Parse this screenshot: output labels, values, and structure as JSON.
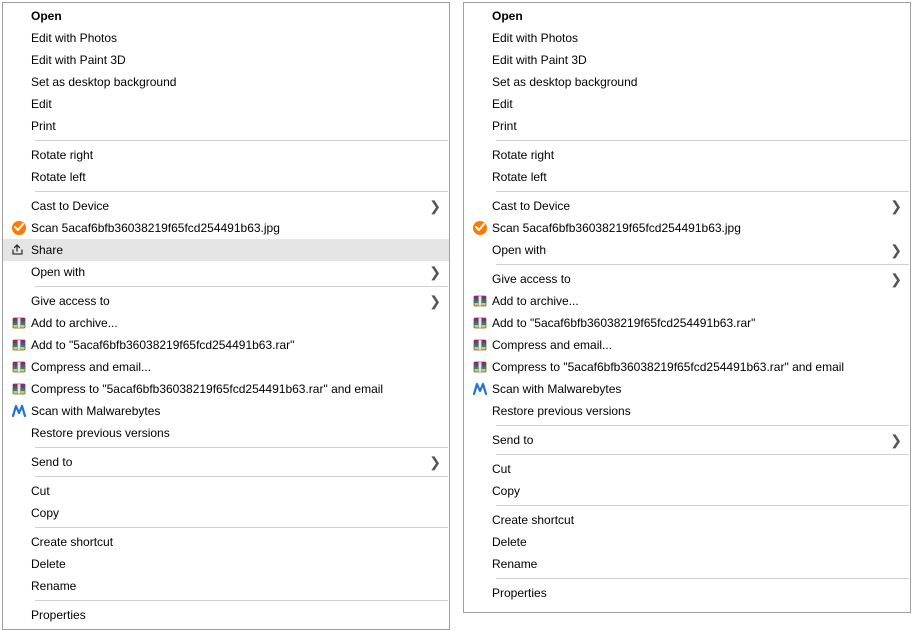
{
  "left_menu": {
    "groups": [
      [
        {
          "id": "open",
          "label": "Open",
          "bold": true,
          "icon": null,
          "submenu": false,
          "highlight": false
        },
        {
          "id": "edit-photos",
          "label": "Edit with Photos",
          "bold": false,
          "icon": null,
          "submenu": false,
          "highlight": false
        },
        {
          "id": "edit-paint3d",
          "label": "Edit with Paint 3D",
          "bold": false,
          "icon": null,
          "submenu": false,
          "highlight": false
        },
        {
          "id": "set-desktop-bg",
          "label": "Set as desktop background",
          "bold": false,
          "icon": null,
          "submenu": false,
          "highlight": false
        },
        {
          "id": "edit",
          "label": "Edit",
          "bold": false,
          "icon": null,
          "submenu": false,
          "highlight": false
        },
        {
          "id": "print",
          "label": "Print",
          "bold": false,
          "icon": null,
          "submenu": false,
          "highlight": false
        }
      ],
      [
        {
          "id": "rotate-right",
          "label": "Rotate right",
          "bold": false,
          "icon": null,
          "submenu": false,
          "highlight": false
        },
        {
          "id": "rotate-left",
          "label": "Rotate left",
          "bold": false,
          "icon": null,
          "submenu": false,
          "highlight": false
        }
      ],
      [
        {
          "id": "cast-to-device",
          "label": "Cast to Device",
          "bold": false,
          "icon": null,
          "submenu": true,
          "highlight": false
        },
        {
          "id": "avast-scan",
          "label": "Scan 5acaf6bfb36038219f65fcd254491b63.jpg",
          "bold": false,
          "icon": "avast",
          "submenu": false,
          "highlight": false
        },
        {
          "id": "share",
          "label": "Share",
          "bold": false,
          "icon": "share",
          "submenu": false,
          "highlight": true
        },
        {
          "id": "open-with",
          "label": "Open with",
          "bold": false,
          "icon": null,
          "submenu": true,
          "highlight": false
        }
      ],
      [
        {
          "id": "give-access-to",
          "label": "Give access to",
          "bold": false,
          "icon": null,
          "submenu": true,
          "highlight": false
        },
        {
          "id": "add-to-archive",
          "label": "Add to archive...",
          "bold": false,
          "icon": "winrar",
          "submenu": false,
          "highlight": false
        },
        {
          "id": "add-to-rar",
          "label": "Add to \"5acaf6bfb36038219f65fcd254491b63.rar\"",
          "bold": false,
          "icon": "winrar",
          "submenu": false,
          "highlight": false
        },
        {
          "id": "compress-email",
          "label": "Compress and email...",
          "bold": false,
          "icon": "winrar",
          "submenu": false,
          "highlight": false
        },
        {
          "id": "compress-to-rar-email",
          "label": "Compress to \"5acaf6bfb36038219f65fcd254491b63.rar\" and email",
          "bold": false,
          "icon": "winrar",
          "submenu": false,
          "highlight": false
        },
        {
          "id": "malwarebytes",
          "label": "Scan with Malwarebytes",
          "bold": false,
          "icon": "malwarebytes",
          "submenu": false,
          "highlight": false
        },
        {
          "id": "restore-prev",
          "label": "Restore previous versions",
          "bold": false,
          "icon": null,
          "submenu": false,
          "highlight": false
        }
      ],
      [
        {
          "id": "send-to",
          "label": "Send to",
          "bold": false,
          "icon": null,
          "submenu": true,
          "highlight": false
        }
      ],
      [
        {
          "id": "cut",
          "label": "Cut",
          "bold": false,
          "icon": null,
          "submenu": false,
          "highlight": false
        },
        {
          "id": "copy",
          "label": "Copy",
          "bold": false,
          "icon": null,
          "submenu": false,
          "highlight": false
        }
      ],
      [
        {
          "id": "create-shortcut",
          "label": "Create shortcut",
          "bold": false,
          "icon": null,
          "submenu": false,
          "highlight": false
        },
        {
          "id": "delete",
          "label": "Delete",
          "bold": false,
          "icon": null,
          "submenu": false,
          "highlight": false
        },
        {
          "id": "rename",
          "label": "Rename",
          "bold": false,
          "icon": null,
          "submenu": false,
          "highlight": false
        }
      ],
      [
        {
          "id": "properties",
          "label": "Properties",
          "bold": false,
          "icon": null,
          "submenu": false,
          "highlight": false
        }
      ]
    ]
  },
  "right_menu": {
    "groups": [
      [
        {
          "id": "open",
          "label": "Open",
          "bold": true,
          "icon": null,
          "submenu": false,
          "highlight": false
        },
        {
          "id": "edit-photos",
          "label": "Edit with Photos",
          "bold": false,
          "icon": null,
          "submenu": false,
          "highlight": false
        },
        {
          "id": "edit-paint3d",
          "label": "Edit with Paint 3D",
          "bold": false,
          "icon": null,
          "submenu": false,
          "highlight": false
        },
        {
          "id": "set-desktop-bg",
          "label": "Set as desktop background",
          "bold": false,
          "icon": null,
          "submenu": false,
          "highlight": false
        },
        {
          "id": "edit",
          "label": "Edit",
          "bold": false,
          "icon": null,
          "submenu": false,
          "highlight": false
        },
        {
          "id": "print",
          "label": "Print",
          "bold": false,
          "icon": null,
          "submenu": false,
          "highlight": false
        }
      ],
      [
        {
          "id": "rotate-right",
          "label": "Rotate right",
          "bold": false,
          "icon": null,
          "submenu": false,
          "highlight": false
        },
        {
          "id": "rotate-left",
          "label": "Rotate left",
          "bold": false,
          "icon": null,
          "submenu": false,
          "highlight": false
        }
      ],
      [
        {
          "id": "cast-to-device",
          "label": "Cast to Device",
          "bold": false,
          "icon": null,
          "submenu": true,
          "highlight": false
        },
        {
          "id": "avast-scan",
          "label": "Scan 5acaf6bfb36038219f65fcd254491b63.jpg",
          "bold": false,
          "icon": "avast",
          "submenu": false,
          "highlight": false
        },
        {
          "id": "open-with",
          "label": "Open with",
          "bold": false,
          "icon": null,
          "submenu": true,
          "highlight": false
        }
      ],
      [
        {
          "id": "give-access-to",
          "label": "Give access to",
          "bold": false,
          "icon": null,
          "submenu": true,
          "highlight": false
        },
        {
          "id": "add-to-archive",
          "label": "Add to archive...",
          "bold": false,
          "icon": "winrar",
          "submenu": false,
          "highlight": false
        },
        {
          "id": "add-to-rar",
          "label": "Add to \"5acaf6bfb36038219f65fcd254491b63.rar\"",
          "bold": false,
          "icon": "winrar",
          "submenu": false,
          "highlight": false
        },
        {
          "id": "compress-email",
          "label": "Compress and email...",
          "bold": false,
          "icon": "winrar",
          "submenu": false,
          "highlight": false
        },
        {
          "id": "compress-to-rar-email",
          "label": "Compress to \"5acaf6bfb36038219f65fcd254491b63.rar\" and email",
          "bold": false,
          "icon": "winrar",
          "submenu": false,
          "highlight": false
        },
        {
          "id": "malwarebytes",
          "label": "Scan with Malwarebytes",
          "bold": false,
          "icon": "malwarebytes",
          "submenu": false,
          "highlight": false
        },
        {
          "id": "restore-prev",
          "label": "Restore previous versions",
          "bold": false,
          "icon": null,
          "submenu": false,
          "highlight": false
        }
      ],
      [
        {
          "id": "send-to",
          "label": "Send to",
          "bold": false,
          "icon": null,
          "submenu": true,
          "highlight": false
        }
      ],
      [
        {
          "id": "cut",
          "label": "Cut",
          "bold": false,
          "icon": null,
          "submenu": false,
          "highlight": false
        },
        {
          "id": "copy",
          "label": "Copy",
          "bold": false,
          "icon": null,
          "submenu": false,
          "highlight": false
        }
      ],
      [
        {
          "id": "create-shortcut",
          "label": "Create shortcut",
          "bold": false,
          "icon": null,
          "submenu": false,
          "highlight": false
        },
        {
          "id": "delete",
          "label": "Delete",
          "bold": false,
          "icon": null,
          "submenu": false,
          "highlight": false
        },
        {
          "id": "rename",
          "label": "Rename",
          "bold": false,
          "icon": null,
          "submenu": false,
          "highlight": false
        }
      ],
      [
        {
          "id": "properties",
          "label": "Properties",
          "bold": false,
          "icon": null,
          "submenu": false,
          "highlight": false
        }
      ]
    ]
  }
}
